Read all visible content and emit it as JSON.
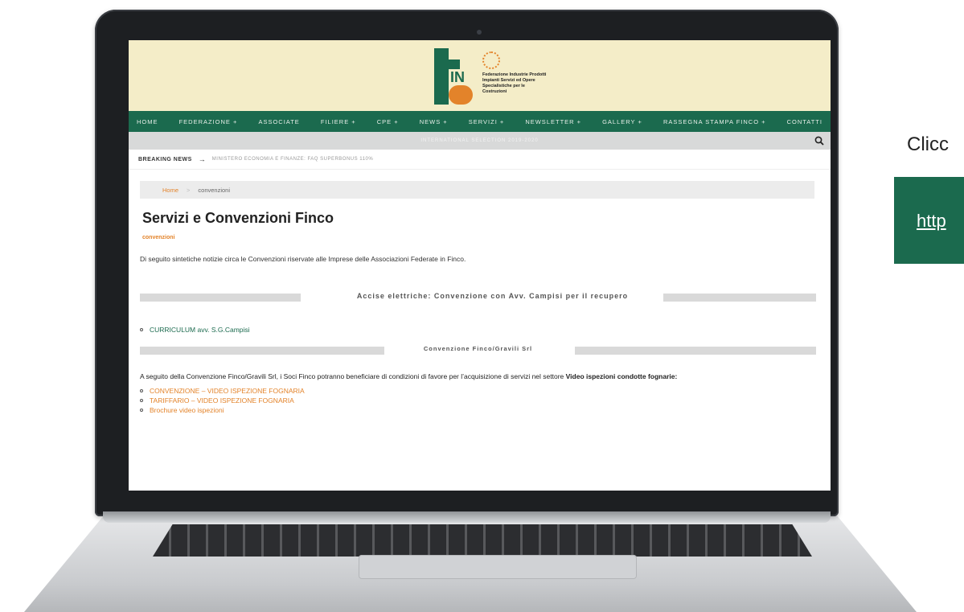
{
  "side": {
    "title": "Clicc",
    "link": "http"
  },
  "header": {
    "logo_letters_top": "IN",
    "logo_text": "Federazione Industrie Prodotti Impianti Servizi ed Opere Specialistiche per le Costruzioni"
  },
  "nav": {
    "items": [
      "HOME",
      "FEDERAZIONE +",
      "ASSOCIATE",
      "FILIERE +",
      "CPE +",
      "NEWS +",
      "SERVIZI +",
      "NEWSLETTER +",
      "GALLERY +",
      "RASSEGNA STAMPA FINCO +",
      "CONTATTI"
    ]
  },
  "subnav": {
    "text": "INTERNATIONAL SELECTION 2019-2020"
  },
  "breaking": {
    "label": "BREAKING NEWS",
    "arrow": "→",
    "text": "MINISTERO ECONOMIA E FINANZE: FAQ SUPERBONUS 110%"
  },
  "breadcrumb": {
    "home": "Home",
    "separator": ">",
    "current": "convenzioni"
  },
  "page": {
    "title": "Servizi e Convenzioni Finco",
    "category": "convenzioni",
    "intro": "Di seguito sintetiche notizie circa le Convenzioni riservate alle Imprese delle Associazioni Federate in  Finco.",
    "section1": "Accise elettriche: Convenzione con Avv. Campisi per il recupero",
    "section1_item": "CURRICULUM avv. S.G.Campisi",
    "section2": "Convenzione Finco/Gravili Srl",
    "para_start": "A seguito della Convenzione Finco/Gravili Srl, i Soci Finco potranno beneficiare di condizioni di favore  per l’acquisizione di servizi  nel settore ",
    "para_bold": "Video ispezioni condotte fognarie:",
    "links": [
      "CONVENZIONE – VIDEO ISPEZIONE FOGNARIA",
      "TARIFFARIO – VIDEO ISPEZIONE FOGNARIA",
      "Brochure video ispezioni"
    ]
  },
  "colors": {
    "brand_green": "#1b6a4e",
    "accent_orange": "#e3832a",
    "header_bg": "#f4edc8"
  },
  "icons": {
    "search": "search-icon"
  }
}
